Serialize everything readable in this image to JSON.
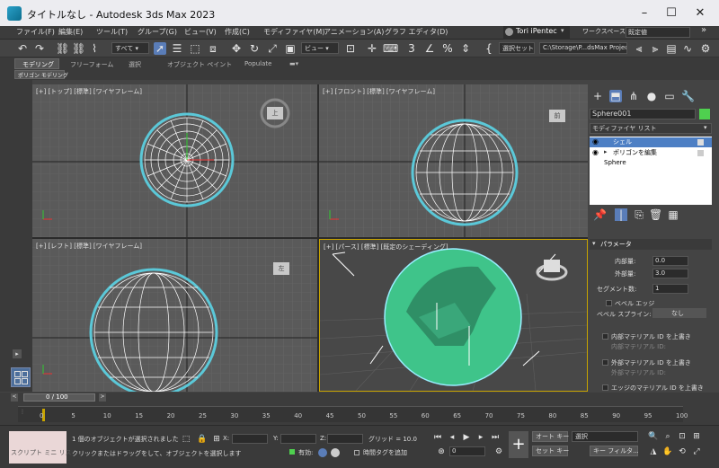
{
  "window": {
    "title": "タイトルなし - Autodesk 3ds Max 2023"
  },
  "menu": {
    "items": [
      "ファイル(F)",
      "編集(E)",
      "ツール(T)",
      "グループ(G)",
      "ビュー(V)",
      "作成(C)",
      "モディファイヤ(M)",
      "アニメーション(A)",
      "グラフ エディタ(D)"
    ],
    "user": "Tori iPentec",
    "workspace_label": "ワークスペース:",
    "workspace_value": "既定値"
  },
  "toolbar": {
    "filter": "すべて",
    "view": "ビュー",
    "selection_set": "選択セット作成",
    "project_path": "C:\\Storage\\P...dsMax Project"
  },
  "ribbon": {
    "tabs": [
      "モデリング",
      "フリーフォーム",
      "選択",
      "オブジェクト ペイント",
      "Populate"
    ],
    "sub_tab": "ポリゴン モデリング"
  },
  "viewports": {
    "top": "[+] [トップ] [標準] [ワイヤフレーム]",
    "front": "[+] [フロント] [標準] [ワイヤフレーム]",
    "left": "[+] [レフト] [標準] [ワイヤフレーム]",
    "perspective": "[+] [パース] [標準] [既定のシェーディング]",
    "cube_top": "上",
    "cube_front": "前",
    "cube_left": "左"
  },
  "command_panel": {
    "object_name": "Sphere001",
    "modifier_list": "モディファイヤ リスト",
    "stack": [
      "シェル",
      "ポリゴンを編集",
      "Sphere"
    ],
    "rollout_title": "パラメータ",
    "params": [
      {
        "label": "内部量:",
        "value": "0.0"
      },
      {
        "label": "外部量:",
        "value": "3.0"
      },
      {
        "label": "セグメント数:",
        "value": "1"
      }
    ],
    "bevel_edge": "ベベル エッジ",
    "bevel_spline_label": "ベベル スプライン:",
    "bevel_spline_value": "なし",
    "inner_mat": "内部マテリアル ID を上書き",
    "inner_mat_id": "内部マテリアル ID:",
    "outer_mat": "外部マテリアル ID を上書き",
    "outer_mat_id": "外部マテリアル ID:",
    "edge_mat": "エッジのマテリアル ID を上書き"
  },
  "timeline": {
    "frame_display": "0 / 100",
    "ticks": [
      "0",
      "5",
      "10",
      "15",
      "20",
      "25",
      "30",
      "35",
      "40",
      "45",
      "50",
      "55",
      "60",
      "65",
      "70",
      "75",
      "80",
      "85",
      "90",
      "95",
      "100"
    ]
  },
  "status": {
    "script_label": "スクリプト ミニ リス",
    "selected": "1 個のオブジェクトが選択されました",
    "hint": "クリックまたはドラッグをして、オブジェクトを選択します",
    "x_label": "X:",
    "y_label": "Y:",
    "z_label": "Z:",
    "grid": "グリッド = 10.0",
    "enabled": "有効:",
    "add_time_tag": "時間タグを追加",
    "autokey": "オート キー",
    "setkey": "セット キー",
    "selected_dd": "選択",
    "key_filter": "キー フィルタ...",
    "frame_value": "0"
  },
  "colors": {
    "accent": "#5bc8d8",
    "sphere_fill": "#3fc48a",
    "object_color": "#4fd04f",
    "title_bg": "#ececf0"
  }
}
